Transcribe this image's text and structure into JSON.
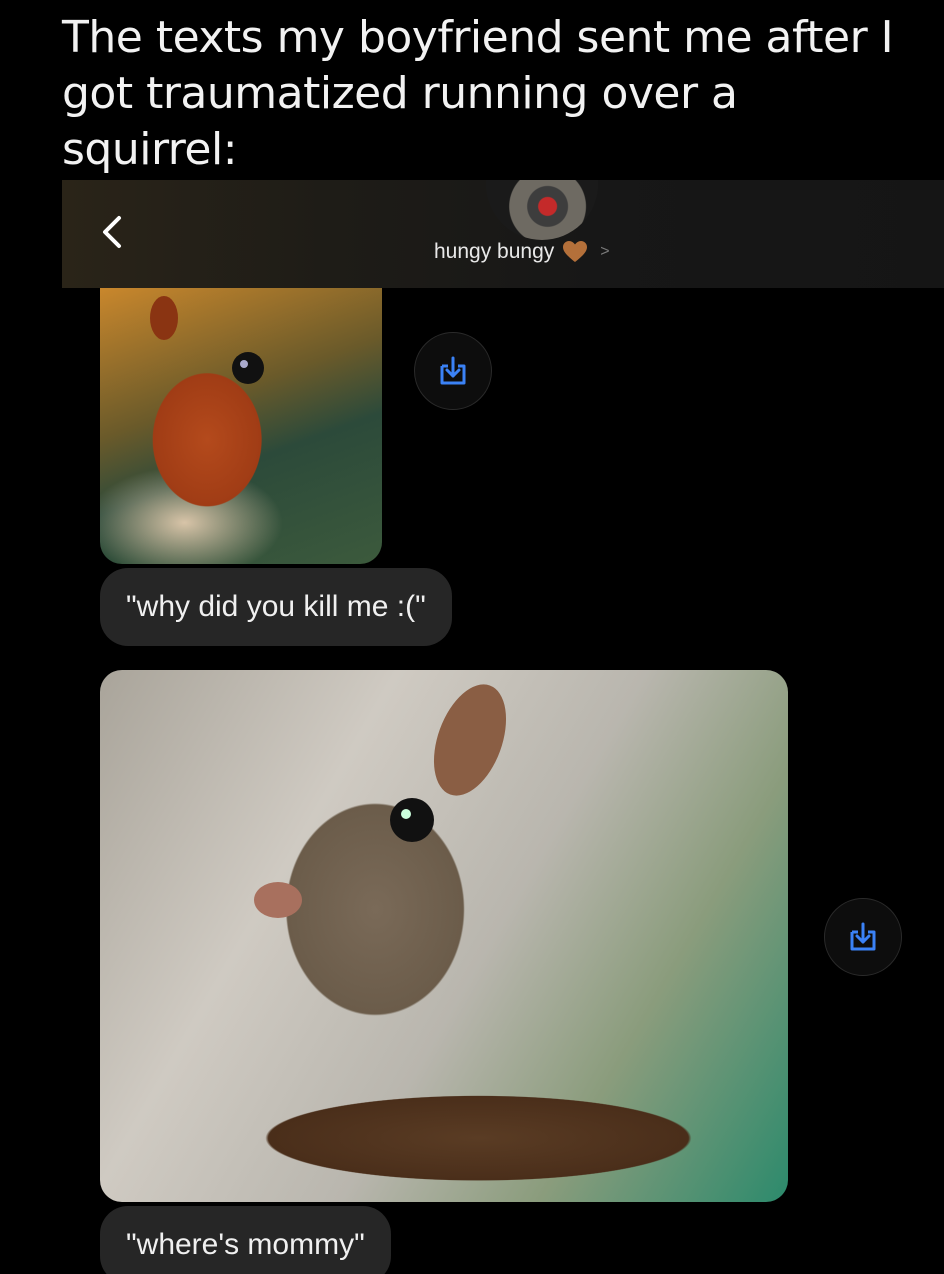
{
  "caption": "The texts my boyfriend sent me after I got traumatized running over a squirrel:",
  "header": {
    "contact_name": "hungy bungy",
    "chevron": ">"
  },
  "messages": [
    {
      "text": "\"why did you kill me :(\""
    },
    {
      "text": "\"where's mommy\""
    }
  ],
  "colors": {
    "accent": "#3b82f6",
    "heart": "#b4703a",
    "bubble": "#262626"
  },
  "icons": [
    "back-icon",
    "heart-icon",
    "save-icon"
  ]
}
